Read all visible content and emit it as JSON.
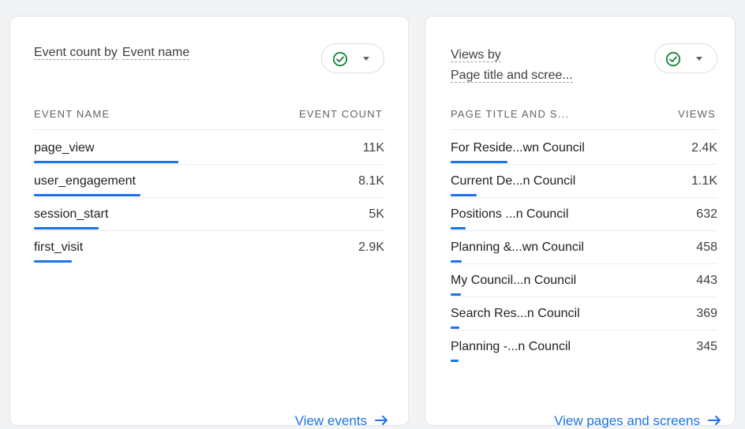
{
  "events_card": {
    "title_part1": "Event count by",
    "title_part2": "Event name",
    "column_left": "EVENT NAME",
    "column_right": "EVENT COUNT",
    "rows": [
      {
        "label": "page_view",
        "value": "11K",
        "share": 1.0
      },
      {
        "label": "user_engagement",
        "value": "8.1K",
        "share": 0.74
      },
      {
        "label": "session_start",
        "value": "5K",
        "share": 0.45
      },
      {
        "label": "first_visit",
        "value": "2.9K",
        "share": 0.26
      }
    ],
    "footer_link": "View events",
    "status_icon": "check-circle-icon"
  },
  "views_card": {
    "title_line1": "Views by",
    "title_line2": "Page title and scree...",
    "column_left": "PAGE TITLE AND S...",
    "column_right": "VIEWS",
    "rows": [
      {
        "label": "For Reside...wn Council",
        "value": "2.4K",
        "share": 1.0
      },
      {
        "label": "Current De...n Council",
        "value": "1.1K",
        "share": 0.46
      },
      {
        "label": "Positions ...n Council",
        "value": "632",
        "share": 0.26
      },
      {
        "label": "Planning &...wn Council",
        "value": "458",
        "share": 0.19
      },
      {
        "label": "My Council...n Council",
        "value": "443",
        "share": 0.18
      },
      {
        "label": "Search Res...n Council",
        "value": "369",
        "share": 0.15
      },
      {
        "label": "Planning -...n Council",
        "value": "345",
        "share": 0.14
      }
    ],
    "footer_link": "View pages and screens",
    "status_icon": "check-circle-icon"
  },
  "colors": {
    "accent": "#1a73e8",
    "check": "#188038"
  }
}
